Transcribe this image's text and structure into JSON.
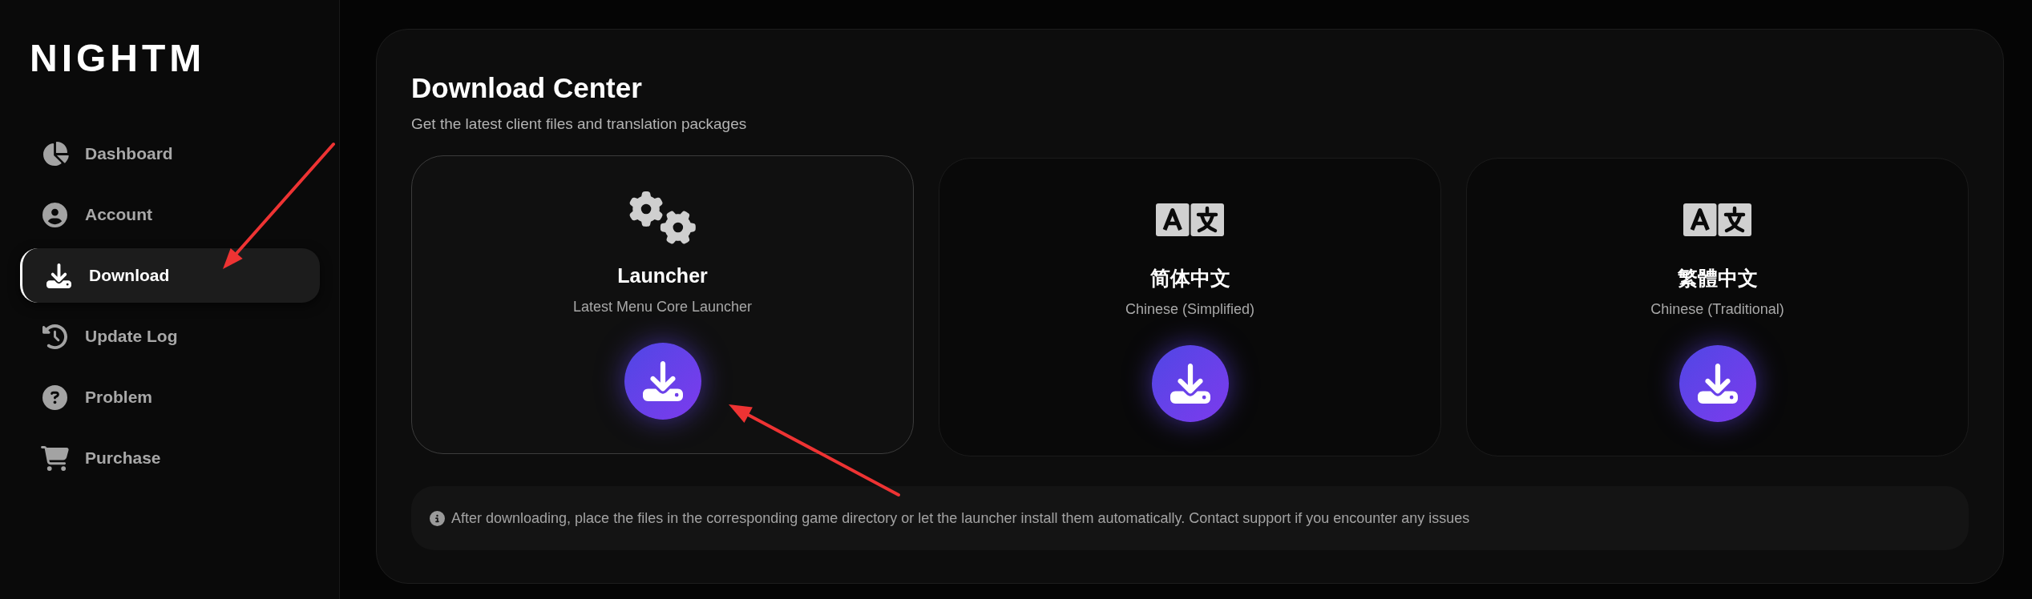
{
  "sidebar": {
    "logo": "NIGHTM",
    "items": [
      {
        "label": "Dashboard",
        "selected": false
      },
      {
        "label": "Account",
        "selected": false
      },
      {
        "label": "Download",
        "selected": true
      },
      {
        "label": "Update Log",
        "selected": false
      },
      {
        "label": "Problem",
        "selected": false
      },
      {
        "label": "Purchase",
        "selected": false
      }
    ]
  },
  "main": {
    "title": "Download Center",
    "subtitle": "Get the latest client files and translation packages",
    "cards": [
      {
        "kind": "app",
        "title": "Launcher",
        "subtitle": "Latest Menu Core Launcher",
        "hovered": true
      },
      {
        "kind": "language",
        "title": "简体中文",
        "subtitle": "Chinese (Simplified)",
        "hovered": false
      },
      {
        "kind": "language",
        "title": "繁體中文",
        "subtitle": "Chinese (Traditional)",
        "hovered": false
      }
    ],
    "notice": "After downloading, place the files in the corresponding game directory or let the launcher install them automatically. Contact support if you encounter any issues"
  }
}
